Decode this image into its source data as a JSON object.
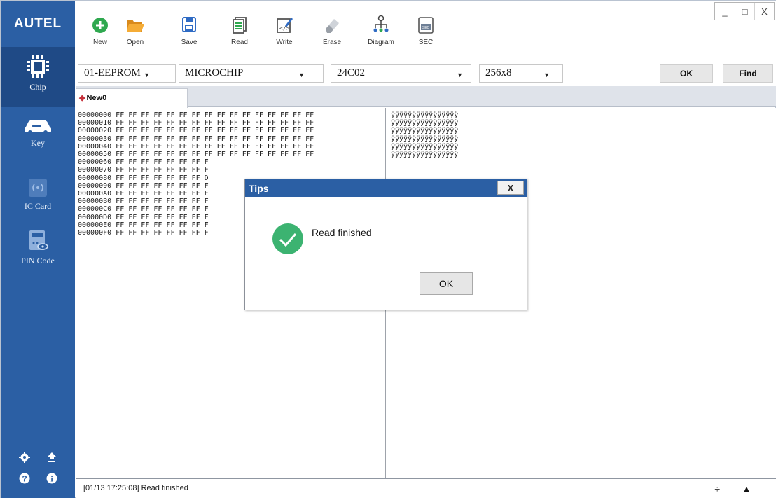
{
  "app": {
    "logo": "AUTEL"
  },
  "sidebar": {
    "items": [
      {
        "label": "Chip",
        "icon": "chip-icon"
      },
      {
        "label": "Key",
        "icon": "car-key-icon"
      },
      {
        "label": "IC Card",
        "icon": "ic-card-icon"
      },
      {
        "label": "PIN Code",
        "icon": "pin-code-icon"
      }
    ],
    "bottom_icons": [
      "settings-icon",
      "upgrade-icon",
      "help-icon",
      "info-icon"
    ]
  },
  "toolbar": {
    "tools": [
      {
        "label": "New",
        "icon": "new-icon"
      },
      {
        "label": "Open",
        "icon": "open-folder-icon"
      },
      {
        "label": "Save",
        "icon": "save-icon"
      },
      {
        "label": "Read",
        "icon": "read-icon"
      },
      {
        "label": "Write",
        "icon": "write-icon"
      },
      {
        "label": "Erase",
        "icon": "erase-icon"
      },
      {
        "label": "Diagram",
        "icon": "diagram-icon"
      },
      {
        "label": "SEC",
        "icon": "sec-icon"
      }
    ],
    "sec_badge": "SEC"
  },
  "window": {
    "minimize": "_",
    "maximize": "□",
    "close": "X"
  },
  "selectors": {
    "type": "01-EEPROM",
    "brand": "MICROCHIP",
    "model": "24C02",
    "size": "256x8",
    "ok_label": "OK",
    "find_label": "Find"
  },
  "tab": {
    "label": "New0"
  },
  "hex": {
    "rows": [
      "00000000 FF FF FF FF FF FF FF FF FF FF FF FF FF FF FF FF",
      "00000010 FF FF FF FF FF FF FF FF FF FF FF FF FF FF FF FF",
      "00000020 FF FF FF FF FF FF FF FF FF FF FF FF FF FF FF FF",
      "00000030 FF FF FF FF FF FF FF FF FF FF FF FF FF FF FF FF",
      "00000040 FF FF FF FF FF FF FF FF FF FF FF FF FF FF FF FF",
      "00000050 FF FF FF FF FF FF FF FF FF FF FF FF FF FF FF FF",
      "00000060 FF FF FF FF FF FF FF F",
      "00000070 FF FF FF FF FF FF FF F",
      "00000080 FF FF FF FF FF FF FF D",
      "00000090 FF FF FF FF FF FF FF F",
      "000000A0 FF FF FF FF FF FF FF F",
      "000000B0 FF FF FF FF FF FF FF F",
      "000000C0 FF FF FF FF FF FF FF F",
      "000000D0 FF FF FF FF FF FF FF F",
      "000000E0 FF FF FF FF FF FF FF F",
      "000000F0 FF FF FF FF FF FF FF F"
    ],
    "ascii_rows": [
      "ÿÿÿÿÿÿÿÿÿÿÿÿÿÿÿÿ",
      "ÿÿÿÿÿÿÿÿÿÿÿÿÿÿÿÿ",
      "ÿÿÿÿÿÿÿÿÿÿÿÿÿÿÿÿ",
      "ÿÿÿÿÿÿÿÿÿÿÿÿÿÿÿÿ",
      "ÿÿÿÿÿÿÿÿÿÿÿÿÿÿÿÿ",
      "ÿÿÿÿÿÿÿÿÿÿÿÿÿÿÿÿ"
    ]
  },
  "dialog": {
    "title": "Tips",
    "close": "X",
    "message": "Read finished",
    "ok_label": "OK",
    "success_color": "#3cb371"
  },
  "status": {
    "message": "[01/13 17:25:08] Read finished",
    "split_icon": "÷",
    "up_icon": "▲"
  },
  "colors": {
    "sidebar": "#2b5fa4",
    "accent_red": "#c6323c",
    "new_green": "#2fa84f",
    "folder_orange": "#f0a830"
  }
}
